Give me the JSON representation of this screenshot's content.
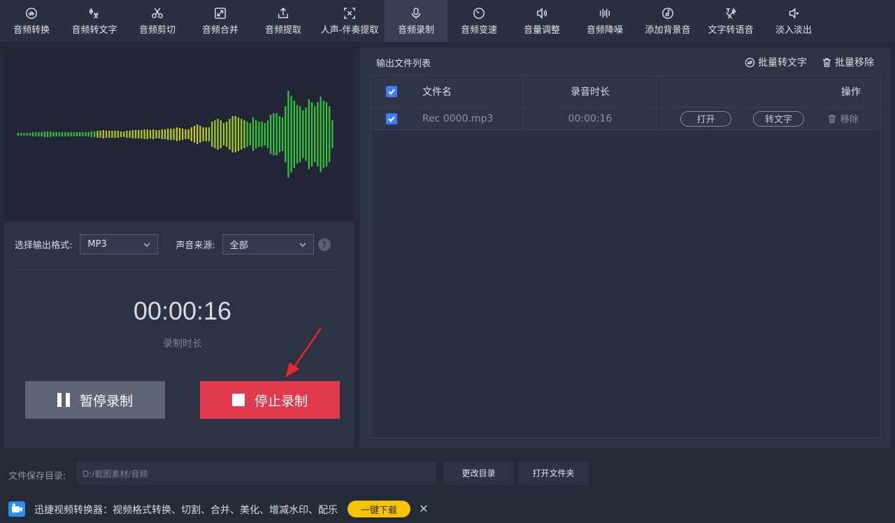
{
  "toolbar": {
    "items": [
      {
        "label": "音频转换",
        "icon": "audio-convert-icon"
      },
      {
        "label": "音频转文字",
        "icon": "speech-to-text-icon"
      },
      {
        "label": "音频剪切",
        "icon": "scissors-icon"
      },
      {
        "label": "音频合并",
        "icon": "merge-icon"
      },
      {
        "label": "音频提取",
        "icon": "extract-icon"
      },
      {
        "label": "人声-伴奏提取",
        "icon": "vocal-extract-icon"
      },
      {
        "label": "音频录制",
        "icon": "microphone-icon",
        "active": true
      },
      {
        "label": "音频变速",
        "icon": "speed-icon"
      },
      {
        "label": "音量调整",
        "icon": "volume-icon"
      },
      {
        "label": "音频降噪",
        "icon": "denoise-icon"
      },
      {
        "label": "添加背景音",
        "icon": "music-disc-icon"
      },
      {
        "label": "文字转语音",
        "icon": "text-to-speech-icon"
      },
      {
        "label": "淡入淡出",
        "icon": "fade-icon"
      }
    ]
  },
  "recorder": {
    "format_label": "选择输出格式:",
    "format_value": "MP3",
    "source_label": "声音来源:",
    "source_value": "全部",
    "help_icon": "?",
    "timer": "00:00:16",
    "timer_label": "录制时长",
    "pause_label": "暂停录制",
    "stop_label": "停止录制"
  },
  "output": {
    "title": "输出文件列表",
    "batch_text": "批量转文字",
    "batch_remove": "批量移除",
    "columns": {
      "name": "文件名",
      "duration": "录音时长",
      "actions": "操作"
    },
    "rows": [
      {
        "name": "Rec 0000.mp3",
        "duration": "00:00:16",
        "open": "打开",
        "to_text": "转文字",
        "remove": "移除",
        "checked": true
      }
    ]
  },
  "save": {
    "label": "文件保存目录:",
    "path": "D:/截图素材/音频",
    "change_btn": "更改目录",
    "open_btn": "打开文件夹"
  },
  "ad": {
    "text": "迅捷视频转换器：视频格式转换、切割、合并、美化、增减水印、配乐",
    "button": "一键下载",
    "close": "✕"
  },
  "colors": {
    "accent": "#3d7eff",
    "stop": "#e03a4e",
    "pause": "#5f6577",
    "wave_start": "#2ecf3a",
    "wave_mid": "#c8d21e",
    "download": "#f6c400"
  }
}
